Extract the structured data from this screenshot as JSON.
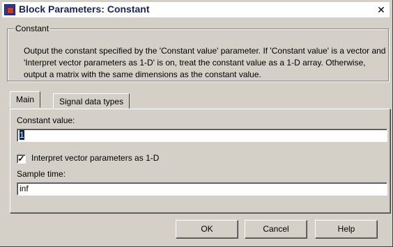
{
  "window": {
    "title": "Block Parameters: Constant",
    "close_glyph": "✕",
    "icon": "simulink-block-icon"
  },
  "group": {
    "label": "Constant",
    "description": "Output the constant specified by the 'Constant value' parameter. If 'Constant value' is a vector and 'Interpret vector parameters as 1-D' is on, treat the constant value as a 1-D array. Otherwise, output a matrix with the same dimensions as the constant value."
  },
  "tabs": [
    {
      "label": "Main",
      "active": true
    },
    {
      "label": "Signal data types",
      "active": false
    }
  ],
  "fields": {
    "constant_value_label": "Constant value:",
    "constant_value": "1",
    "interpret_label": "Interpret vector parameters as 1-D",
    "interpret_checked": true,
    "sample_time_label": "Sample time:",
    "sample_time_value": "inf"
  },
  "buttons": {
    "ok": "OK",
    "cancel": "Cancel",
    "help": "Help"
  },
  "colors": {
    "dialog_bg": "#d4d0c8",
    "selection_bg": "#0a246a"
  }
}
